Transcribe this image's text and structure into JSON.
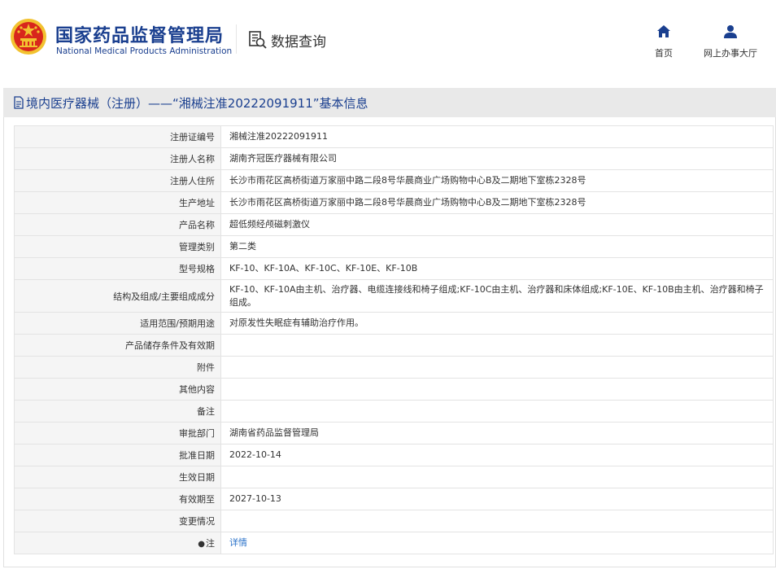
{
  "header": {
    "brand_cn": "国家药品监督管理局",
    "brand_en": "National Medical Products Administration",
    "data_query": "数据查询",
    "nav": [
      {
        "label": "首页",
        "icon": "home-icon"
      },
      {
        "label": "网上办事大厅",
        "icon": "user-icon"
      }
    ],
    "colors": {
      "brand": "#1a3f8f",
      "logo_red": "#d8261c",
      "logo_gold": "#f2c230",
      "link": "#2a72c9"
    }
  },
  "title": "境内医疗器械（注册）——“湘械注准20222091911”基本信息",
  "rows": [
    {
      "label": "注册证编号",
      "value": "湘械注准20222091911"
    },
    {
      "label": "注册人名称",
      "value": "湖南齐冠医疗器械有限公司"
    },
    {
      "label": "注册人住所",
      "value": "长沙市雨花区高桥街道万家丽中路二段8号华晨商业广场购物中心B及二期地下室栋2328号"
    },
    {
      "label": "生产地址",
      "value": "长沙市雨花区高桥街道万家丽中路二段8号华晨商业广场购物中心B及二期地下室栋2328号"
    },
    {
      "label": "产品名称",
      "value": "超低频经颅磁刺激仪"
    },
    {
      "label": "管理类别",
      "value": "第二类"
    },
    {
      "label": "型号规格",
      "value": "KF-10、KF-10A、KF-10C、KF-10E、KF-10B"
    },
    {
      "label": "结构及组成/主要组成成分",
      "value": "KF-10、KF-10A由主机、治疗器、电缆连接线和椅子组成;KF-10C由主机、治疗器和床体组成;KF-10E、KF-10B由主机、治疗器和椅子组成。"
    },
    {
      "label": "适用范围/预期用途",
      "value": "对原发性失眠症有辅助治疗作用。"
    },
    {
      "label": "产品储存条件及有效期",
      "value": ""
    },
    {
      "label": "附件",
      "value": ""
    },
    {
      "label": "其他内容",
      "value": ""
    },
    {
      "label": "备注",
      "value": ""
    },
    {
      "label": "审批部门",
      "value": "湖南省药品监督管理局"
    },
    {
      "label": "批准日期",
      "value": "2022-10-14"
    },
    {
      "label": "生效日期",
      "value": ""
    },
    {
      "label": "有效期至",
      "value": "2027-10-13"
    },
    {
      "label": "变更情况",
      "value": ""
    },
    {
      "label": "注",
      "value": "详情"
    }
  ]
}
